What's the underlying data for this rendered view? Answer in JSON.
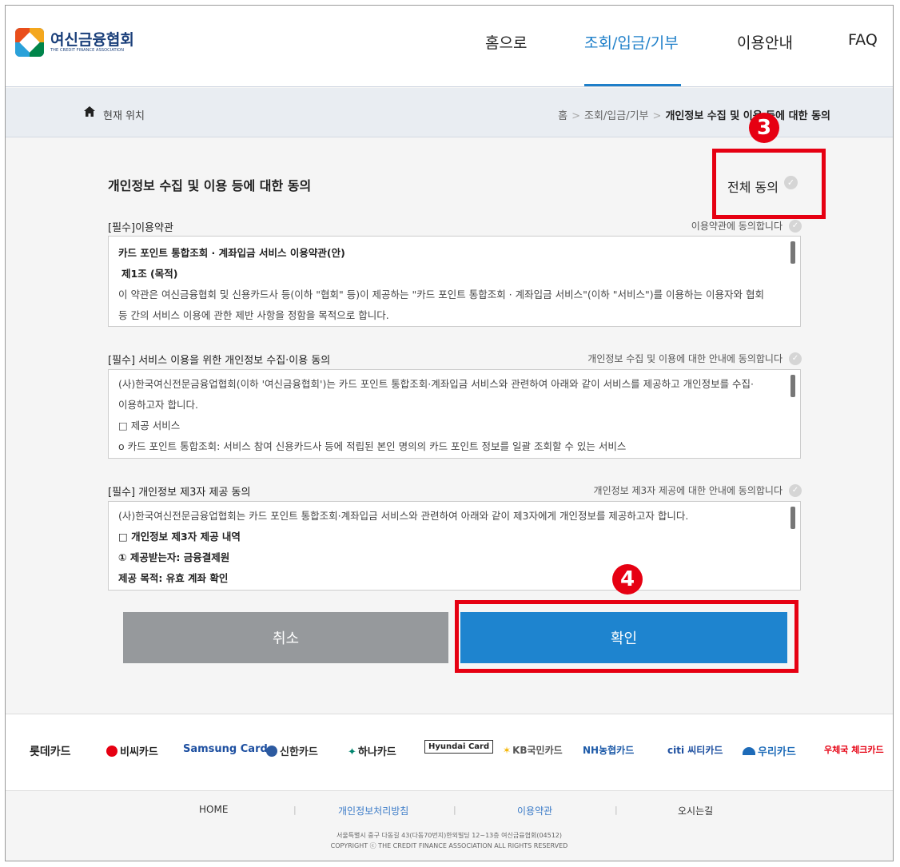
{
  "brand": {
    "name_ko": "여신금융협회",
    "name_en": "THE CREDIT FINANCE ASSOCIATION"
  },
  "nav": {
    "items": [
      {
        "label": "홈으로"
      },
      {
        "label": "조회/입금/기부"
      },
      {
        "label": "이용안내"
      },
      {
        "label": "FAQ"
      }
    ],
    "active": "조회/입금/기부"
  },
  "location": {
    "label": "현재 위치",
    "crumbs": [
      "홈",
      "조회/입금/기부",
      "개인정보 수집 및 이용 등에 대한 동의"
    ]
  },
  "page": {
    "title": "개인정보 수집 및 이용 등에 대한 동의",
    "all_agree": "전체 동의"
  },
  "sections": [
    {
      "title": "[필수]이용약관",
      "agree": "이용약관에 동의합니다",
      "lines": [
        "카드 포인트 통합조회 · 계좌입금 서비스 이용약관(안)",
        "제1조 (목적)",
        "이 약관은 여신금융협회 및 신용카드사 등(이하 \"협회\" 등)이 제공하는 \"카드 포인트 통합조회 · 계좌입금 서비스\"(이하 \"서비스\")를 이용하는 이용자와 협회",
        "등 간의 서비스 이용에 관한 제반 사항을 정함을 목적으로 합니다."
      ]
    },
    {
      "title": "[필수] 서비스 이용을 위한 개인정보 수집·이용 동의",
      "agree": "개인정보 수집 및 이용에 대한 안내에 동의합니다",
      "lines": [
        "(사)한국여신전문금융업협회(이하 '여신금융협회')는 카드 포인트 통합조회·계좌입금 서비스와 관련하여 아래와 같이 서비스를 제공하고 개인정보를 수집·",
        "이용하고자 합니다.",
        "□ 제공 서비스",
        "o 카드 포인트 통합조회: 서비스 참여 신용카드사 등에 적립된 본인 명의의 카드 포인트 정보를 일괄 조회할 수 있는 서비스"
      ]
    },
    {
      "title": "[필수] 개인정보 제3자 제공 동의",
      "agree": "개인정보 제3자 제공에 대한 안내에 동의합니다",
      "lines": [
        "(사)한국여신전문금융업협회는 카드 포인트 통합조회·계좌입금 서비스와 관련하여 아래와 같이 제3자에게 개인정보를 제공하고자 합니다.",
        "□ 개인정보 제3자 제공 내역",
        "① 제공받는자: 금융결제원",
        "제공 목적: 유효 계좌 확인"
      ]
    }
  ],
  "buttons": {
    "cancel": "취소",
    "confirm": "확인"
  },
  "annotations": {
    "badge_all_agree": "3",
    "badge_confirm": "4"
  },
  "partners": [
    {
      "label": "롯데카드"
    },
    {
      "label": "비씨카드"
    },
    {
      "label": "Samsung Card"
    },
    {
      "label": "신한카드"
    },
    {
      "label": "하나카드"
    },
    {
      "label": "Hyundai Card"
    },
    {
      "label": "KB국민카드"
    },
    {
      "label": "NH농협카드"
    },
    {
      "label": "citi 씨티카드"
    },
    {
      "label": "우리카드"
    },
    {
      "label": "우체국 체크카드"
    }
  ],
  "footer": {
    "links": [
      "HOME",
      "개인정보처리방침",
      "이용약관",
      "오시는길"
    ],
    "address": "서울특별시 중구 다동길 43(다동70번지)한외빌딩 12~13층 여신금융협회(04512)",
    "copyright": "COPYRIGHT ⓒ THE CREDIT FINANCE ASSOCIATION ALL RIGHTS RESERVED"
  },
  "colors": {
    "accent": "#1e84cf",
    "annotation": "#e60012",
    "cancel": "#96999c"
  }
}
